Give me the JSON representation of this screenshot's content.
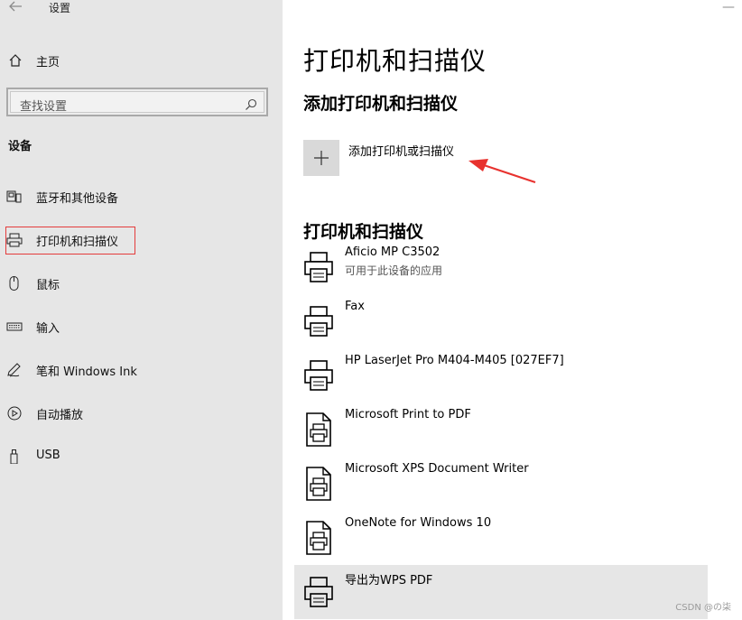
{
  "window": {
    "title": "设置"
  },
  "sidebar": {
    "home_label": "主页",
    "search_placeholder": "查找设置",
    "section_title": "设备",
    "items": [
      {
        "label": "蓝牙和其他设备",
        "icon": "bluetooth-devices-icon"
      },
      {
        "label": "打印机和扫描仪",
        "icon": "printer-icon",
        "selected": true
      },
      {
        "label": "鼠标",
        "icon": "mouse-icon"
      },
      {
        "label": "输入",
        "icon": "keyboard-icon"
      },
      {
        "label": "笔和 Windows Ink",
        "icon": "pen-icon"
      },
      {
        "label": "自动播放",
        "icon": "autoplay-icon"
      },
      {
        "label": "USB",
        "icon": "usb-icon"
      }
    ]
  },
  "main": {
    "page_title": "打印机和扫描仪",
    "add_section_title": "添加打印机和扫描仪",
    "add_button_label": "添加打印机或扫描仪",
    "list_title": "打印机和扫描仪",
    "printers": [
      {
        "name": "Aficio MP C3502",
        "status": "可用于此设备的应用",
        "icon": "printer-icon"
      },
      {
        "name": "Fax",
        "status": "",
        "icon": "printer-icon"
      },
      {
        "name": "HP LaserJet Pro M404-M405 [027EF7]",
        "status": "",
        "icon": "printer-icon"
      },
      {
        "name": "Microsoft Print to PDF",
        "status": "",
        "icon": "document-printer-icon"
      },
      {
        "name": "Microsoft XPS Document Writer",
        "status": "",
        "icon": "document-printer-icon"
      },
      {
        "name": "OneNote for Windows 10",
        "status": "",
        "icon": "document-printer-icon"
      },
      {
        "name": "导出为WPS PDF",
        "status": "",
        "icon": "printer-icon",
        "highlighted": true
      }
    ]
  },
  "watermark": "CSDN @の柒",
  "colors": {
    "sidebar_bg": "#e6e6e6",
    "selection_border": "#e43c3c",
    "annotation_arrow": "#e8322e"
  }
}
